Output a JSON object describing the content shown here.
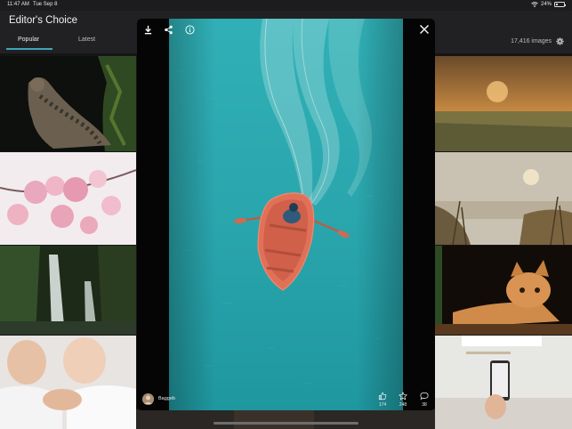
{
  "status_bar": {
    "time": "11:47 AM",
    "date": "Tue Sep 8",
    "battery": "24%",
    "battery_level": 0.24
  },
  "header": {
    "title": "Editor's Choice",
    "tabs": [
      {
        "label": "Popular",
        "active": true
      },
      {
        "label": "Latest",
        "active": false
      }
    ],
    "image_count": "17,416 images"
  },
  "viewer": {
    "author": "Baggeb",
    "likes": "174",
    "favorites": "248",
    "comments": "38"
  },
  "colors": {
    "accent": "#3fa6b8",
    "water": "#2aa7ad",
    "boat": "#e07158"
  },
  "icons": [
    "download-icon",
    "share-icon",
    "info-icon",
    "close-icon",
    "like-icon",
    "star-icon",
    "comment-icon",
    "gear-icon"
  ]
}
